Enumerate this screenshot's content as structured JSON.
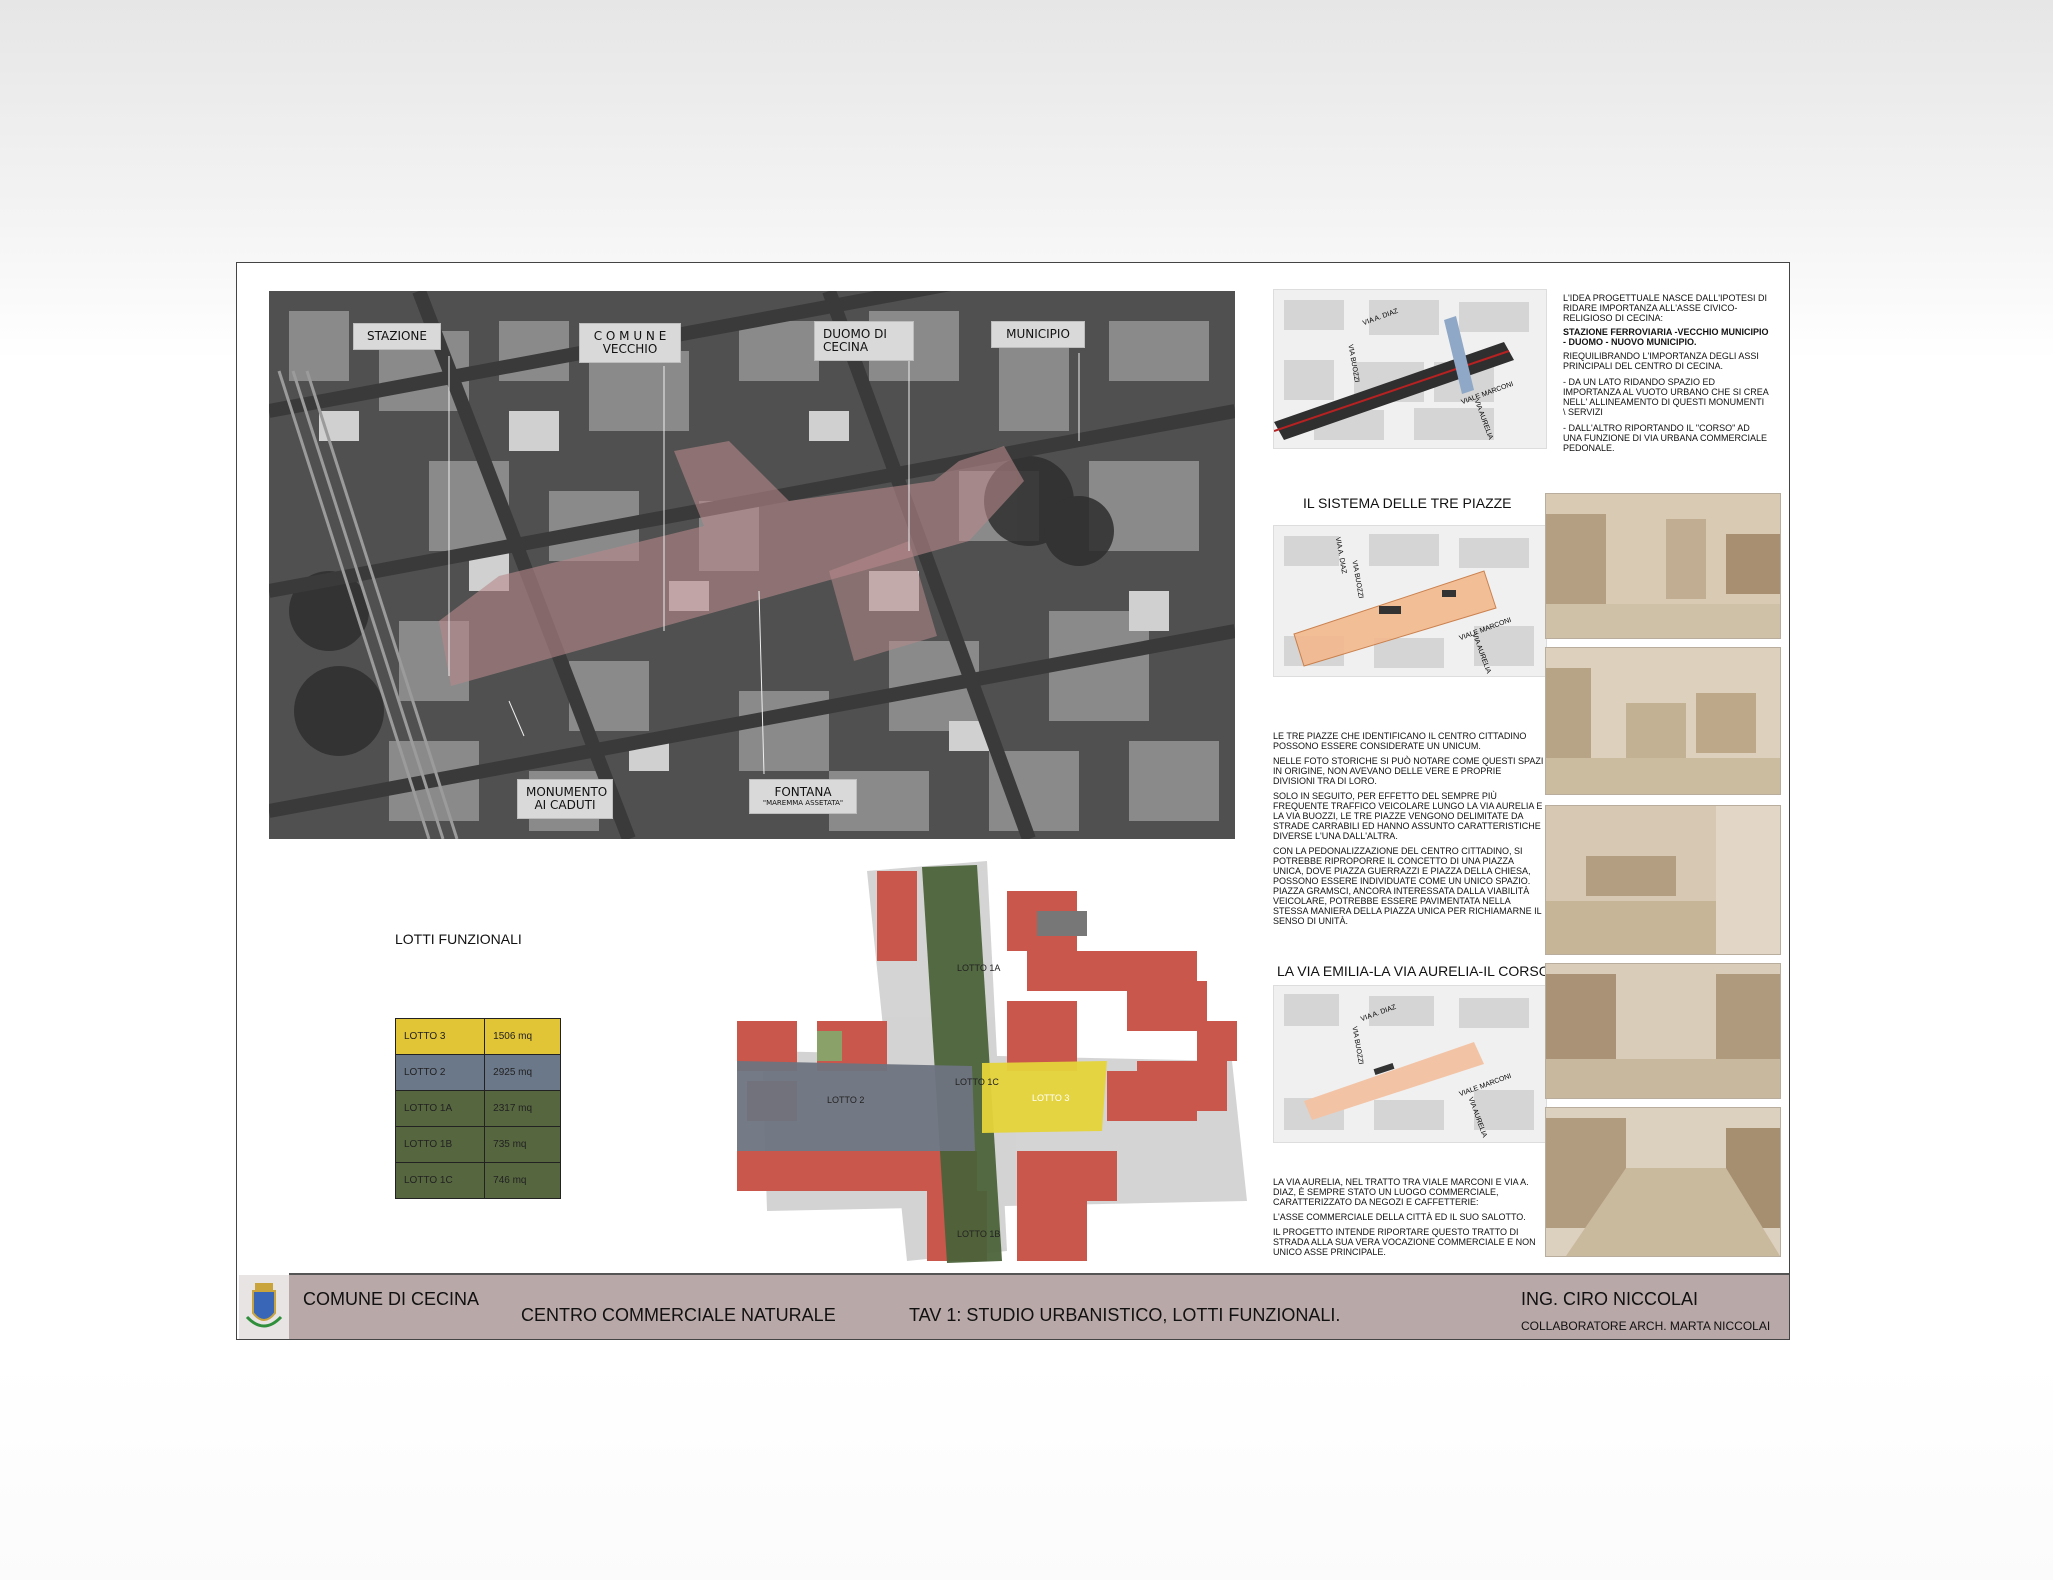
{
  "aerial_labels": {
    "stazione": "STAZIONE",
    "comune_vecchio": "C O M U N E VECCHIO",
    "duomo": "DUOMO DI CECINA",
    "municipio": "MUNICIPIO",
    "monumento": "MONUMENTO AI CADUTI",
    "fontana": "FONTANA",
    "fontana_sub": "\"MAREMMA ASSETATA\""
  },
  "intro_text": {
    "p1": "L'idea progettuale nasce dall'ipotesi di ridare importanza all'asse civico-religioso di Cecina:",
    "p2": "Stazione ferroviaria -Vecchio Municipio - Duomo - Nuovo Municipio.",
    "p3": "Riequilibrando l'importanza degli assi principali del centro di Cecina.",
    "p4": "- Da un lato ridando spazio ed importanza al vuoto urbano che si crea nell' allineamento di questi monumenti \\ servizi",
    "p5": "- dall'altro riportando il \"corso\" ad una funzione di via urbana commerciale pedonale."
  },
  "map_labels": {
    "via_diaz": "VIA A. DIAZ",
    "via_buozzi": "VIA BUOZZI",
    "viale_marconi": "VIALE MARCONI",
    "via_aurelia": "VIA AURELIA"
  },
  "tre_piazze": {
    "title": "IL SISTEMA DELLE TRE PIAZZE",
    "p1": "Le tre piazze che identificano il centro cittadino possono essere considerate un unicum.",
    "p2": "Nelle foto storiche si può notare come questi spazi in origine, non avevano delle vere e proprie divisioni tra di loro.",
    "p3": "Solo in seguito, per effetto del sempre più frequente traffico veicolare lungo la via Aurelia e la via Buozzi, le tre piazze vengono delimitate da strade carrabili ed hanno assunto caratteristiche diverse l'una dall'altra.",
    "p4": "Con la pedonalizzazione del centro cittadino, si potrebbe riproporre il concetto di una piazza unica, dove Piazza Guerrazzi e Piazza della Chiesa, possono essere individuate come un unico spazio.",
    "p5": "Piazza Gramsci, ancora interessata dalla viabilità veicolare, potrebbe essere pavimentata nella stessa maniera della piazza unica per richiamarne il senso di unità."
  },
  "via_emilia": {
    "title": "LA VIA EMILIA-LA VIA AURELIA-IL CORSO",
    "p1": "La via Aurelia, nel tratto tra viale Marconi e via A. Diaz, è sempre stato un luogo commerciale, caratterizzato da negozi e caffetterie:",
    "p2": "l'asse commerciale della città ed il suo salotto.",
    "p3": "Il progetto intende riportare questo tratto di strada alla sua vera vocazione commerciale e non unico asse principale."
  },
  "lotti": {
    "title": "LOTTI FUNZIONALI",
    "rows": [
      {
        "name": "LOTTO 3",
        "area": "1506 mq",
        "color": "#e2c437"
      },
      {
        "name": "LOTTO 2",
        "area": "2925 mq",
        "color": "#6b7889"
      },
      {
        "name": "LOTTO 1A",
        "area": "2317 mq",
        "color": "#56663f"
      },
      {
        "name": "LOTTO 1B",
        "area": "735 mq",
        "color": "#56663f"
      },
      {
        "name": "LOTTO 1C",
        "area": "746 mq",
        "color": "#56663f"
      }
    ],
    "plan_labels": {
      "l1a": "LOTTO 1A",
      "l1c": "LOTTO 1C",
      "l1b": "LOTTO 1B",
      "l2": "LOTTO 2",
      "l3": "LOTTO 3"
    }
  },
  "footer": {
    "comune": "COMUNE DI CECINA",
    "progetto": "CENTRO COMMERCIALE NATURALE",
    "tavola": "TAV 1: STUDIO URBANISTICO,  LOTTI FUNZIONALI.",
    "ingegnere": "ING. CIRO NICCOLAI",
    "collaboratore": "COLLABORATORE ARCH. MARTA NICCOLAI"
  }
}
